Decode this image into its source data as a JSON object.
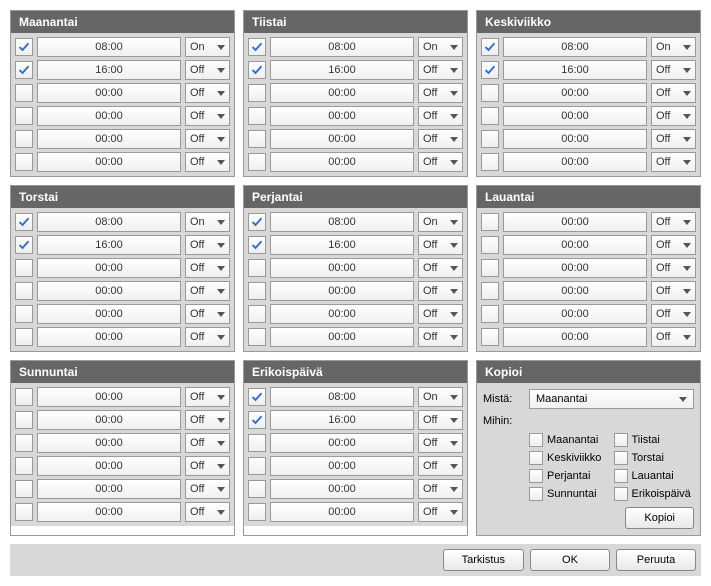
{
  "days": [
    {
      "id": "maanantai",
      "name": "Maanantai",
      "rows": [
        {
          "checked": true,
          "time": "08:00",
          "state": "On"
        },
        {
          "checked": true,
          "time": "16:00",
          "state": "Off"
        },
        {
          "checked": false,
          "time": "00:00",
          "state": "Off"
        },
        {
          "checked": false,
          "time": "00:00",
          "state": "Off"
        },
        {
          "checked": false,
          "time": "00:00",
          "state": "Off"
        },
        {
          "checked": false,
          "time": "00:00",
          "state": "Off"
        }
      ]
    },
    {
      "id": "tiistai",
      "name": "Tiistai",
      "rows": [
        {
          "checked": true,
          "time": "08:00",
          "state": "On"
        },
        {
          "checked": true,
          "time": "16:00",
          "state": "Off"
        },
        {
          "checked": false,
          "time": "00:00",
          "state": "Off"
        },
        {
          "checked": false,
          "time": "00:00",
          "state": "Off"
        },
        {
          "checked": false,
          "time": "00:00",
          "state": "Off"
        },
        {
          "checked": false,
          "time": "00:00",
          "state": "Off"
        }
      ]
    },
    {
      "id": "keskiviikko",
      "name": "Keskiviikko",
      "rows": [
        {
          "checked": true,
          "time": "08:00",
          "state": "On"
        },
        {
          "checked": true,
          "time": "16:00",
          "state": "Off"
        },
        {
          "checked": false,
          "time": "00:00",
          "state": "Off"
        },
        {
          "checked": false,
          "time": "00:00",
          "state": "Off"
        },
        {
          "checked": false,
          "time": "00:00",
          "state": "Off"
        },
        {
          "checked": false,
          "time": "00:00",
          "state": "Off"
        }
      ]
    },
    {
      "id": "torstai",
      "name": "Torstai",
      "rows": [
        {
          "checked": true,
          "time": "08:00",
          "state": "On"
        },
        {
          "checked": true,
          "time": "16:00",
          "state": "Off"
        },
        {
          "checked": false,
          "time": "00:00",
          "state": "Off"
        },
        {
          "checked": false,
          "time": "00:00",
          "state": "Off"
        },
        {
          "checked": false,
          "time": "00:00",
          "state": "Off"
        },
        {
          "checked": false,
          "time": "00:00",
          "state": "Off"
        }
      ]
    },
    {
      "id": "perjantai",
      "name": "Perjantai",
      "rows": [
        {
          "checked": true,
          "time": "08:00",
          "state": "On"
        },
        {
          "checked": true,
          "time": "16:00",
          "state": "Off"
        },
        {
          "checked": false,
          "time": "00:00",
          "state": "Off"
        },
        {
          "checked": false,
          "time": "00:00",
          "state": "Off"
        },
        {
          "checked": false,
          "time": "00:00",
          "state": "Off"
        },
        {
          "checked": false,
          "time": "00:00",
          "state": "Off"
        }
      ]
    },
    {
      "id": "lauantai",
      "name": "Lauantai",
      "rows": [
        {
          "checked": false,
          "time": "00:00",
          "state": "Off"
        },
        {
          "checked": false,
          "time": "00:00",
          "state": "Off"
        },
        {
          "checked": false,
          "time": "00:00",
          "state": "Off"
        },
        {
          "checked": false,
          "time": "00:00",
          "state": "Off"
        },
        {
          "checked": false,
          "time": "00:00",
          "state": "Off"
        },
        {
          "checked": false,
          "time": "00:00",
          "state": "Off"
        }
      ]
    },
    {
      "id": "sunnuntai",
      "name": "Sunnuntai",
      "rows": [
        {
          "checked": false,
          "time": "00:00",
          "state": "Off"
        },
        {
          "checked": false,
          "time": "00:00",
          "state": "Off"
        },
        {
          "checked": false,
          "time": "00:00",
          "state": "Off"
        },
        {
          "checked": false,
          "time": "00:00",
          "state": "Off"
        },
        {
          "checked": false,
          "time": "00:00",
          "state": "Off"
        },
        {
          "checked": false,
          "time": "00:00",
          "state": "Off"
        }
      ]
    },
    {
      "id": "erikoispaiva",
      "name": "Erikoispäivä",
      "rows": [
        {
          "checked": true,
          "time": "08:00",
          "state": "On"
        },
        {
          "checked": true,
          "time": "16:00",
          "state": "Off"
        },
        {
          "checked": false,
          "time": "00:00",
          "state": "Off"
        },
        {
          "checked": false,
          "time": "00:00",
          "state": "Off"
        },
        {
          "checked": false,
          "time": "00:00",
          "state": "Off"
        },
        {
          "checked": false,
          "time": "00:00",
          "state": "Off"
        }
      ]
    }
  ],
  "copy": {
    "title": "Kopioi",
    "from_label": "Mistä:",
    "from_value": "Maanantai",
    "to_label": "Mihin:",
    "targets": [
      {
        "label": "Maanantai",
        "checked": false
      },
      {
        "label": "Tiistai",
        "checked": false
      },
      {
        "label": "Keskiviikko",
        "checked": false
      },
      {
        "label": "Torstai",
        "checked": false
      },
      {
        "label": "Perjantai",
        "checked": false
      },
      {
        "label": "Lauantai",
        "checked": false
      },
      {
        "label": "Sunnuntai",
        "checked": false
      },
      {
        "label": "Erikoispäivä",
        "checked": false
      }
    ],
    "button": "Kopioi"
  },
  "footer": {
    "check": "Tarkistus",
    "ok": "OK",
    "cancel": "Peruuta"
  }
}
